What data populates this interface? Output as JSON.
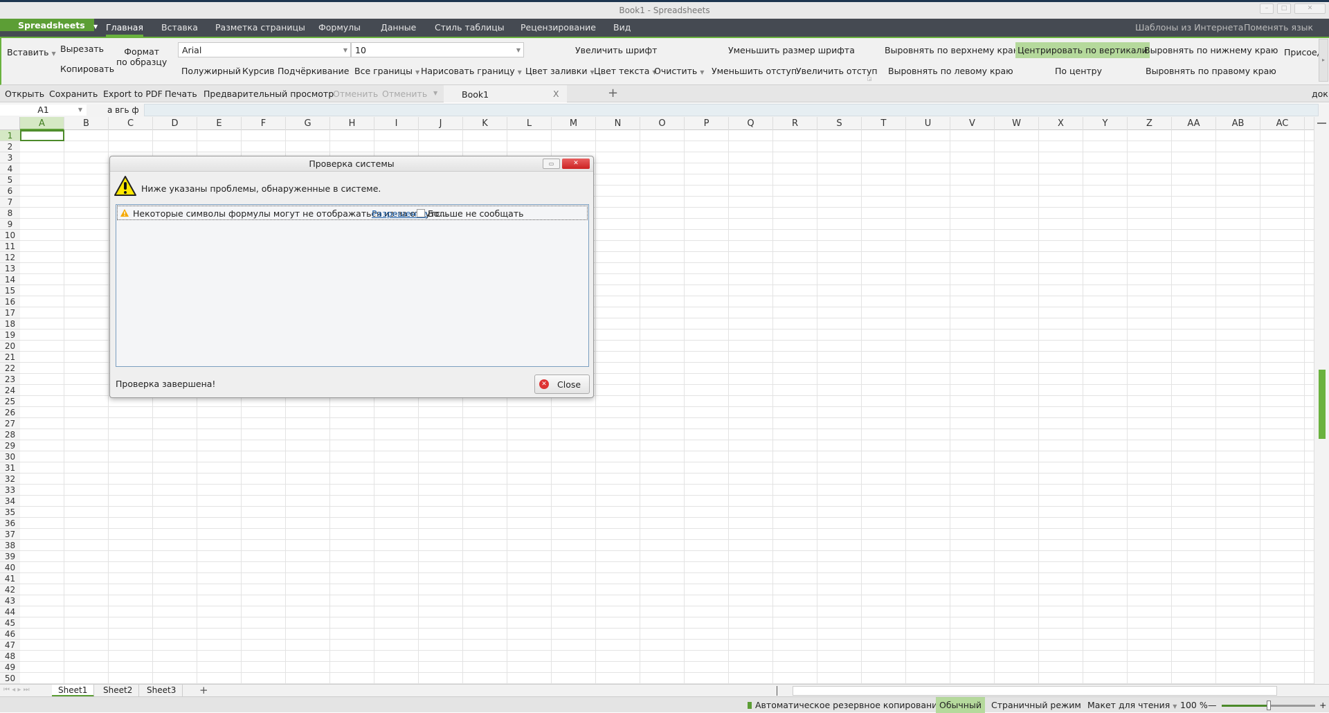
{
  "window": {
    "title": "Book1 - Spreadsheets",
    "controls": [
      "minimize",
      "maximize",
      "close"
    ]
  },
  "menu": {
    "brand": "Spreadsheets",
    "tabs": [
      "Главная",
      "Вставка",
      "Разметка страницы",
      "Формулы",
      "Данные",
      "Стиль таблицы",
      "Рецензирование",
      "Вид"
    ],
    "active_tab": "Главная",
    "right": [
      "Шаблоны из Интернета",
      "Поменять язык"
    ]
  },
  "ribbon": {
    "paste": "Вставить",
    "cut": "Вырезать",
    "copy": "Копировать",
    "format_painter_1": "Формат",
    "format_painter_2": "по образцу",
    "font": "Arial",
    "size": "10",
    "bold": "Полужирный",
    "italic": "Курсив",
    "underline": "Подчёркивание",
    "all_borders": "Все границы",
    "draw_border": "Нарисовать границу",
    "fill_color": "Цвет заливки",
    "text_color": "Цвет текста",
    "clear": "Очистить",
    "decrease_indent": "Уменьшить отступ",
    "increase_indent": "Увеличить отступ",
    "increase_font": "Увеличить шрифт",
    "decrease_font": "Уменьшить размер шрифта",
    "align_top": "Выровнять по верхнему краю",
    "center_vertical": "Центрировать по вертикали",
    "align_bottom": "Выровнять по нижнему краю",
    "merge": "Присоед",
    "align_left": "Выровнять по левому краю",
    "center": "По центру",
    "align_right": "Выровнять по правому краю",
    "accent": "#b5d99c"
  },
  "quickbar": {
    "open": "Открыть",
    "save": "Сохранить",
    "export_pdf": "Export to PDF",
    "print": "Печать",
    "preview": "Предварительный просмотр",
    "undo": "Отменить",
    "redo": "Отменить",
    "doc_tab": "Book1",
    "doc_close": "X",
    "new_tab": "+",
    "right": "док"
  },
  "formula": {
    "name_box": "A1",
    "label": "а вгь ф",
    "value": ""
  },
  "grid": {
    "columns": [
      "A",
      "B",
      "C",
      "D",
      "E",
      "F",
      "G",
      "H",
      "I",
      "J",
      "K",
      "L",
      "M",
      "N",
      "O",
      "P",
      "Q",
      "R",
      "S",
      "T",
      "U",
      "V",
      "W",
      "X",
      "Y",
      "Z",
      "AA",
      "AB",
      "AC"
    ],
    "rows": [
      1,
      2,
      3,
      4,
      5,
      6,
      7,
      8,
      9,
      10,
      11,
      12,
      13,
      14,
      15,
      16,
      17,
      18,
      19,
      20,
      21,
      22,
      23,
      24,
      25,
      26,
      27,
      28,
      29,
      30,
      31,
      32,
      33,
      34,
      35,
      36,
      37,
      38,
      39,
      40,
      41,
      42,
      43,
      44,
      45,
      46,
      47,
      48,
      49,
      50
    ],
    "selected_cell": "A1"
  },
  "sheets": {
    "tabs": [
      "Sheet1",
      "Sheet2",
      "Sheet3"
    ],
    "active": "Sheet1",
    "add": "+"
  },
  "status": {
    "backup": "Автоматическое резервное копирование",
    "normal": "Обычный",
    "page_mode": "Страничный режим",
    "reading": "Макет для чтения",
    "zoom": "100 %",
    "zoom_minus": "—",
    "zoom_plus": "+",
    "zoom_level": 100
  },
  "dialog": {
    "title": "Проверка системы",
    "header": "Ниже указаны проблемы, обнаруженные в системе.",
    "items": [
      {
        "text": "Некоторые символы формулы могут не отображаться из-за отсутс...",
        "link": "Разрешение",
        "checkbox": "Больше не сообщать",
        "checked": false
      }
    ],
    "footer": "Проверка завершена!",
    "close": "Close"
  }
}
